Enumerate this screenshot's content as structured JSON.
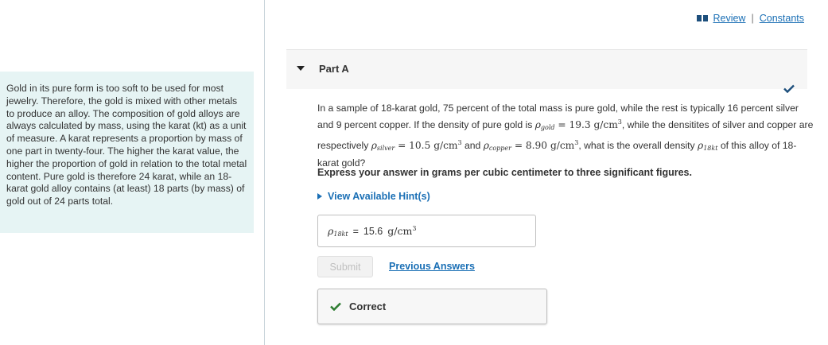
{
  "intro": {
    "text": "Gold in its pure form is too soft to be used for most jewelry. Therefore, the gold is mixed with other metals to produce an alloy. The composition of gold alloys are always calculated by mass, using the karat (kt) as a unit of measure. A karat represents a proportion by mass of one part in twenty-four. The higher the karat value, the higher the proportion of gold in relation to the total metal content. Pure gold is therefore 24 karat, while an 18-karat gold alloy contains (at least) 18 parts (by mass) of gold out of 24 parts total."
  },
  "links": {
    "review": "Review",
    "separator": "|",
    "constants": "Constants"
  },
  "part": {
    "title": "Part A"
  },
  "question": {
    "t1": "In a sample of 18-karat gold, 75 percent of the total mass is pure gold, while the rest is typically 16 percent silver and 9 percent copper. If the density of pure gold is ",
    "rho_gold": "ρ",
    "gold_sub": "gold",
    "gold_val": " = 19.3 g/cm",
    "gold_exp": "3",
    "t2": ", while the densitites of silver and copper are respectively ",
    "rho_silver": "ρ",
    "silver_sub": "silver",
    "silver_val": " = 10.5 g/cm",
    "silver_exp": "3",
    "t3": " and ",
    "rho_copper": "ρ",
    "copper_sub": "copper",
    "copper_val": " = 8.90 g/cm",
    "copper_exp": "3",
    "t4": ", what is the overall density ",
    "rho_18kt": "ρ",
    "kt_sub": "18kt",
    "t5": " of this alloy of 18-karat gold?"
  },
  "instruction": "Express your answer in grams per cubic centimeter to three significant figures.",
  "hints": {
    "label": "View Available Hint(s)"
  },
  "answer": {
    "symbol": "ρ",
    "symbol_sub": "18kt",
    "equals": "=",
    "value": "15.6",
    "unit": "g/cm",
    "unit_exp": "3"
  },
  "actions": {
    "submit": "Submit",
    "previous_answers": "Previous Answers"
  },
  "feedback": {
    "label": "Correct"
  },
  "colors": {
    "accent": "#1a6fb5",
    "correct": "#2e7d32",
    "intro_bg": "#e6f4f4"
  }
}
